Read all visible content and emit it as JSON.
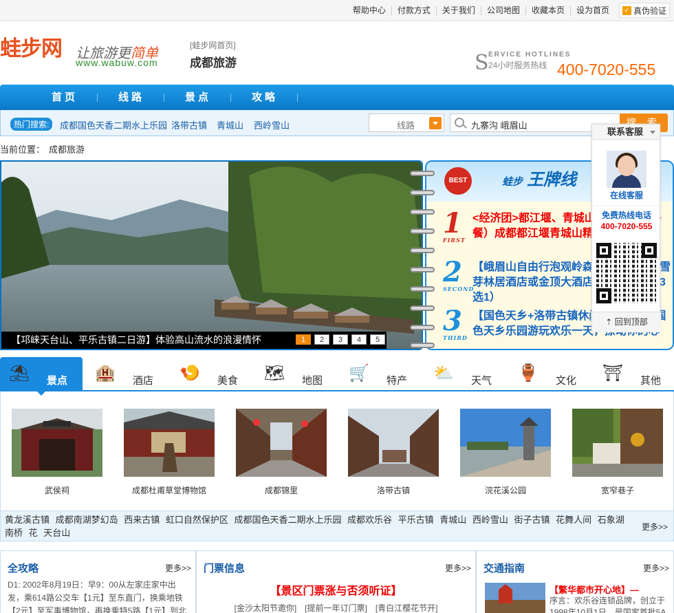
{
  "top_links": [
    "帮助中心",
    "付款方式",
    "关于我们",
    "公司地图",
    "收藏本页",
    "设为首页"
  ],
  "verify_label": "真伪验证",
  "logo": {
    "text": "蛙步网",
    "slogan_a": "让旅游更",
    "slogan_b": "简单",
    "url": "www.wabuw.com"
  },
  "home_link": "[蛙步网首页]",
  "city": "成都旅游",
  "service": {
    "s": "S",
    "en": "ERVICE HOTLINES",
    "cn": "24小时服务热线",
    "hotline": "400-7020-555"
  },
  "nav": [
    "首页",
    "线路",
    "景点",
    "攻略"
  ],
  "hot": {
    "label": "热门搜索:",
    "items": [
      "成都国色天香二期水上乐园",
      "洛带古镇",
      "青城山",
      "西岭雪山"
    ]
  },
  "search": {
    "type": "线路",
    "keywords": "九寨沟 峨眉山",
    "button": "搜 索"
  },
  "breadcrumb": {
    "label": "当前位置：",
    "value": "成都旅游"
  },
  "slider": {
    "caption": "【邛崃天台山、平乐古镇二日游】体验高山流水的浪漫情怀",
    "pages": [
      "1",
      "2",
      "3",
      "4",
      "5"
    ]
  },
  "ace": {
    "brand": "蛙步",
    "title": "王牌线",
    "badge": "BEST",
    "items": [
      {
        "num": "1",
        "tag": "FIRST",
        "text": "<经济团>都江堰、青城山一日游（含午餐）成都都江堰青城山精华一日游"
      },
      {
        "num": "2",
        "tag": "SECOND",
        "text": "【峨眉山自由行泡观岭森林温泉】入住雪芽林居酒店或金顶大酒店等精华酒店（3选1）"
      },
      {
        "num": "3",
        "tag": "THIRD",
        "text": "【国色天乡+洛带古镇休闲一日游】到国色天乡乐园游玩欢乐一天，撩动你的心"
      }
    ]
  },
  "kefu": {
    "title": "联系客服",
    "online": "在线客服",
    "line": "免费热线电话",
    "tel": "400-7020-555",
    "top": "回到顶部"
  },
  "tabs": [
    {
      "label": "景点",
      "icon": "⛱"
    },
    {
      "label": "酒店",
      "icon": "🏨"
    },
    {
      "label": "美食",
      "icon": "🍤"
    },
    {
      "label": "地图",
      "icon": "🗺"
    },
    {
      "label": "特产",
      "icon": "🛒"
    },
    {
      "label": "天气",
      "icon": "⛅"
    },
    {
      "label": "文化",
      "icon": "🏺"
    },
    {
      "label": "其他",
      "icon": "⛩"
    }
  ],
  "spots": [
    "武侯祠",
    "成都杜甫草堂博物馆",
    "成都锦里",
    "洛带古镇",
    "浣花溪公园",
    "宽窄巷子"
  ],
  "more_spots": "黄龙溪古镇 成都南湖梦幻岛 西来古镇 虹口自然保护区 成都国色天香二期水上乐园 成都欢乐谷 平乐古镇 青城山 西岭雪山 街子古镇 花舞人间 石象湖 南桥 花 天台山",
  "more_label": "更多>>",
  "col1": {
    "title": "全攻略",
    "more": "更多>>",
    "body": "D1: 2002年8月19日：早9：00从左家庄家中出发，乘614路公交车【1元】至东直门，换乘地铁【2元】至军事博物馆，再换乘特5路【1元】到北京西客站。"
  },
  "col2": {
    "title": "门票信息",
    "more": "更多>>",
    "headline": "【景区门票涨与否须听证】",
    "links": "[金沙太阳节邀你]　[提前一年订门票]　[青白江樱花节开]"
  },
  "col3": {
    "title": "交通指南",
    "more": "更多>>",
    "headline": "【繁华都市开心地】—",
    "body": "序言：欢乐谷连锁品牌，创立于1998年10月1日，是国家首批5A"
  }
}
